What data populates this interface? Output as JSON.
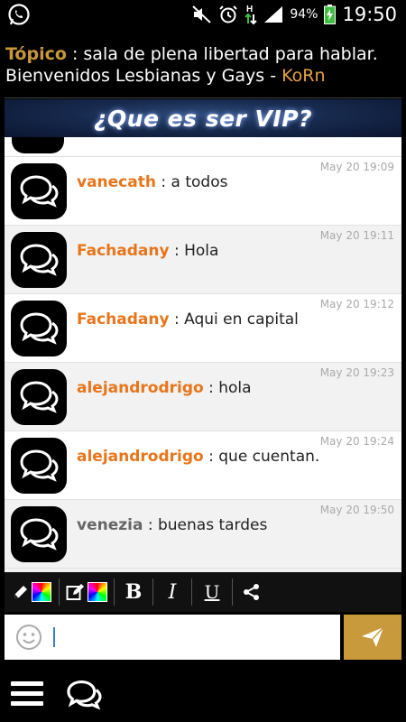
{
  "status_bar": {
    "battery": "94%",
    "time": "19:50",
    "icons": [
      "whatsapp-icon",
      "mute-icon",
      "alarm-icon",
      "data-arrows-icon",
      "signal-icon",
      "battery-charging-icon"
    ]
  },
  "topic": {
    "label": "Tópico",
    "separator": " : ",
    "text": "sala de plena libertad para hablar. Bienvenidos Lesbianas y Gays - ",
    "owner": "KoRn"
  },
  "vip_banner": {
    "text": "¿Que es ser VIP?"
  },
  "messages": [
    {
      "user": "vanecath",
      "sep": " : ",
      "text": "a todos",
      "time": "May 20 19:09"
    },
    {
      "user": "Fachadany",
      "sep": " : ",
      "text": "Hola",
      "time": "May 20 19:11"
    },
    {
      "user": "Fachadany",
      "sep": " : ",
      "text": "Aqui en capital",
      "time": "May 20 19:12"
    },
    {
      "user": "alejandrodrigo",
      "sep": " : ",
      "text": "hola",
      "time": "May 20 19:23"
    },
    {
      "user": "alejandrodrigo",
      "sep": " : ",
      "text": "que cuentan.",
      "time": "May 20 19:24"
    },
    {
      "user": "venezia",
      "sep": " : ",
      "text": "buenas tardes",
      "time": "May 20 19:50"
    }
  ],
  "toolbar": {
    "bold": "B",
    "italic": "I",
    "underline": "U",
    "icons": [
      "pencil-icon",
      "edit-icon",
      "share-icon"
    ]
  },
  "input": {
    "value": "",
    "placeholder": ""
  },
  "colors": {
    "accent_gold": "#c89a3c",
    "username_orange": "#e8751a",
    "topic_label": "#c8973c"
  }
}
